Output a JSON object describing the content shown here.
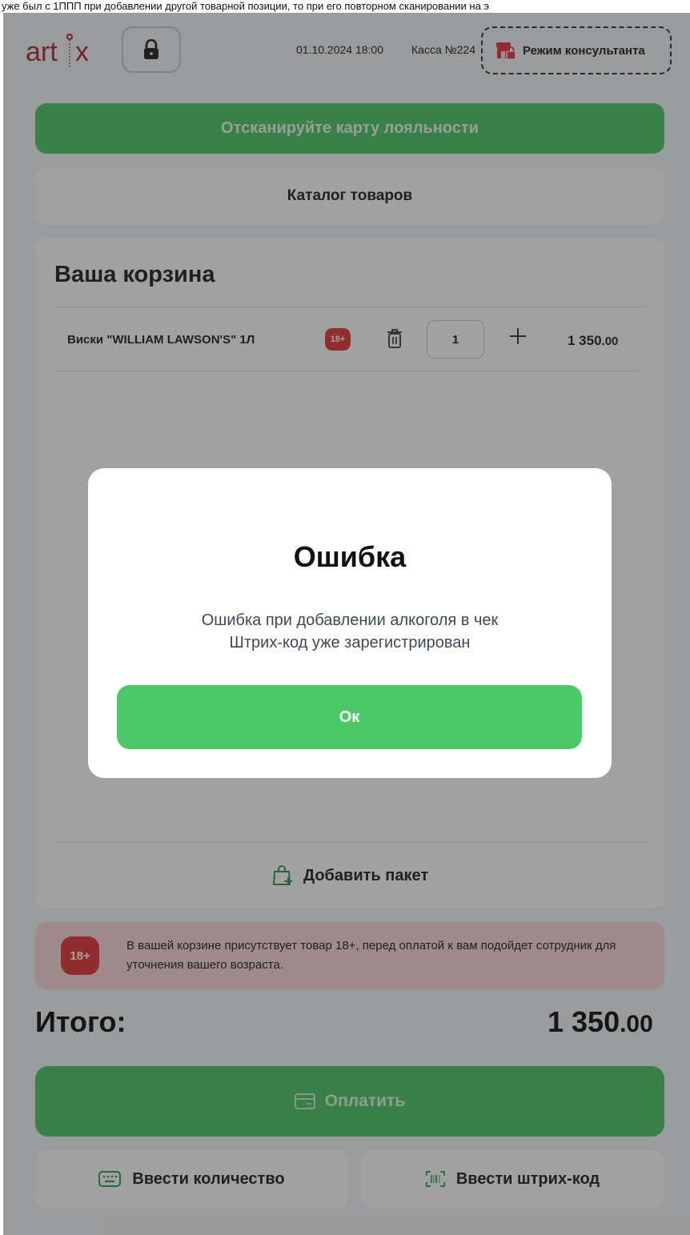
{
  "caption": "уже был с 1ППП при добавлении другой товарной позиции, то при его повторном сканировании на э",
  "header": {
    "logo_text": "artx",
    "datetime": "01.10.2024 18:00",
    "register": "Касса №224",
    "consultant_mode": "Режим консультанта"
  },
  "loyalty_button": "Отсканируйте карту лояльности",
  "catalog_button": "Каталог товаров",
  "cart": {
    "title": "Ваша корзина",
    "items": [
      {
        "name": "Виски \"WILLIAM LAWSON'S\" 1Л",
        "age_badge": "18+",
        "quantity": "1",
        "price_int": "1 350",
        "price_dec": ".00"
      }
    ],
    "add_bag": "Добавить пакет"
  },
  "age_alert": {
    "badge": "18+",
    "text": "В вашей корзине присутствует товар 18+, перед оплатой к вам подойдет сотрудник для уточнения вашего возраста."
  },
  "total": {
    "label": "Итого:",
    "value_int": "1 350",
    "value_dec": ".00"
  },
  "pay_button": "Оплатить",
  "enter_quantity_button": "Ввести количество",
  "enter_barcode_button": "Ввести штрих-код",
  "modal": {
    "title": "Ошибка",
    "message_line1": "Ошибка при добавлении алкоголя в чек",
    "message_line2": "Штрих-код уже зарегистрирован",
    "ok_button": "Ок"
  },
  "colors": {
    "brand": "#b5282e",
    "accent_green": "#4cc966",
    "age_red": "#e4373c",
    "alert_bg": "#fbd7d7"
  }
}
